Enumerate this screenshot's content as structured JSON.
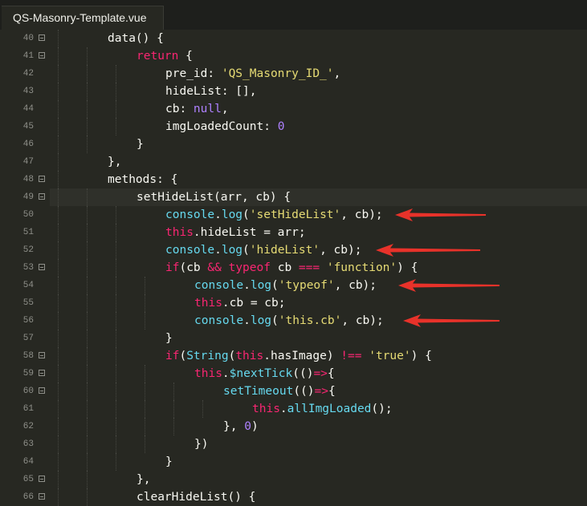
{
  "tab": {
    "filename": "QS-Masonry-Template.vue"
  },
  "current_line": 49,
  "lines": [
    {
      "num": "40",
      "fold": true,
      "indent": 2,
      "tokens": [
        [
          "p",
          "data() {"
        ]
      ]
    },
    {
      "num": "41",
      "fold": true,
      "indent": 3,
      "tokens": [
        [
          "k",
          "return"
        ],
        [
          "p",
          " {"
        ]
      ]
    },
    {
      "num": "42",
      "fold": false,
      "indent": 4,
      "tokens": [
        [
          "p",
          "pre_id: "
        ],
        [
          "s",
          "'QS_Masonry_ID_'"
        ],
        [
          "p",
          ","
        ]
      ]
    },
    {
      "num": "43",
      "fold": false,
      "indent": 4,
      "tokens": [
        [
          "p",
          "hideList: [],"
        ]
      ]
    },
    {
      "num": "44",
      "fold": false,
      "indent": 4,
      "tokens": [
        [
          "p",
          "cb: "
        ],
        [
          "n",
          "null"
        ],
        [
          "p",
          ","
        ]
      ]
    },
    {
      "num": "45",
      "fold": false,
      "indent": 4,
      "tokens": [
        [
          "p",
          "imgLoadedCount: "
        ],
        [
          "n",
          "0"
        ]
      ]
    },
    {
      "num": "46",
      "fold": false,
      "indent": 3,
      "tokens": [
        [
          "p",
          "}"
        ]
      ]
    },
    {
      "num": "47",
      "fold": false,
      "indent": 2,
      "tokens": [
        [
          "p",
          "},"
        ]
      ]
    },
    {
      "num": "48",
      "fold": true,
      "indent": 2,
      "tokens": [
        [
          "p",
          "methods: {"
        ]
      ]
    },
    {
      "num": "49",
      "fold": true,
      "indent": 3,
      "tokens": [
        [
          "p",
          "setHideList(arr, cb) {"
        ]
      ]
    },
    {
      "num": "50",
      "fold": false,
      "indent": 4,
      "tokens": [
        [
          "f",
          "console"
        ],
        [
          "p",
          "."
        ],
        [
          "f",
          "log"
        ],
        [
          "p",
          "("
        ],
        [
          "s",
          "'setHideList'"
        ],
        [
          "p",
          ", cb);"
        ]
      ]
    },
    {
      "num": "51",
      "fold": false,
      "indent": 4,
      "tokens": [
        [
          "k",
          "this"
        ],
        [
          "p",
          ".hideList = arr;"
        ]
      ]
    },
    {
      "num": "52",
      "fold": false,
      "indent": 4,
      "tokens": [
        [
          "f",
          "console"
        ],
        [
          "p",
          "."
        ],
        [
          "f",
          "log"
        ],
        [
          "p",
          "("
        ],
        [
          "s",
          "'hideList'"
        ],
        [
          "p",
          ", cb);"
        ]
      ]
    },
    {
      "num": "53",
      "fold": true,
      "indent": 4,
      "tokens": [
        [
          "k",
          "if"
        ],
        [
          "p",
          "(cb "
        ],
        [
          "k",
          "&&"
        ],
        [
          "p",
          " "
        ],
        [
          "k",
          "typeof"
        ],
        [
          "p",
          " cb "
        ],
        [
          "k",
          "==="
        ],
        [
          "p",
          " "
        ],
        [
          "s",
          "'function'"
        ],
        [
          "p",
          ") {"
        ]
      ]
    },
    {
      "num": "54",
      "fold": false,
      "indent": 5,
      "tokens": [
        [
          "f",
          "console"
        ],
        [
          "p",
          "."
        ],
        [
          "f",
          "log"
        ],
        [
          "p",
          "("
        ],
        [
          "s",
          "'typeof'"
        ],
        [
          "p",
          ", cb);"
        ]
      ]
    },
    {
      "num": "55",
      "fold": false,
      "indent": 5,
      "tokens": [
        [
          "k",
          "this"
        ],
        [
          "p",
          ".cb = cb;"
        ]
      ]
    },
    {
      "num": "56",
      "fold": false,
      "indent": 5,
      "tokens": [
        [
          "f",
          "console"
        ],
        [
          "p",
          "."
        ],
        [
          "f",
          "log"
        ],
        [
          "p",
          "("
        ],
        [
          "s",
          "'this.cb'"
        ],
        [
          "p",
          ", cb);"
        ]
      ]
    },
    {
      "num": "57",
      "fold": false,
      "indent": 4,
      "tokens": [
        [
          "p",
          "}"
        ]
      ]
    },
    {
      "num": "58",
      "fold": true,
      "indent": 4,
      "tokens": [
        [
          "k",
          "if"
        ],
        [
          "p",
          "("
        ],
        [
          "f",
          "String"
        ],
        [
          "p",
          "("
        ],
        [
          "k",
          "this"
        ],
        [
          "p",
          ".hasImage) "
        ],
        [
          "k",
          "!=="
        ],
        [
          "p",
          " "
        ],
        [
          "s",
          "'true'"
        ],
        [
          "p",
          ") {"
        ]
      ]
    },
    {
      "num": "59",
      "fold": true,
      "indent": 5,
      "tokens": [
        [
          "k",
          "this"
        ],
        [
          "p",
          "."
        ],
        [
          "f",
          "$nextTick"
        ],
        [
          "p",
          "(()"
        ],
        [
          "k",
          "=>"
        ],
        [
          "p",
          "{"
        ]
      ]
    },
    {
      "num": "60",
      "fold": true,
      "indent": 6,
      "tokens": [
        [
          "f",
          "setTimeout"
        ],
        [
          "p",
          "(()"
        ],
        [
          "k",
          "=>"
        ],
        [
          "p",
          "{"
        ]
      ]
    },
    {
      "num": "61",
      "fold": false,
      "indent": 7,
      "tokens": [
        [
          "k",
          "this"
        ],
        [
          "p",
          "."
        ],
        [
          "f",
          "allImgLoaded"
        ],
        [
          "p",
          "();"
        ]
      ]
    },
    {
      "num": "62",
      "fold": false,
      "indent": 6,
      "tokens": [
        [
          "p",
          "}, "
        ],
        [
          "n",
          "0"
        ],
        [
          "p",
          ")"
        ]
      ]
    },
    {
      "num": "63",
      "fold": false,
      "indent": 5,
      "tokens": [
        [
          "p",
          "})"
        ]
      ]
    },
    {
      "num": "64",
      "fold": false,
      "indent": 4,
      "tokens": [
        [
          "p",
          "}"
        ]
      ]
    },
    {
      "num": "65",
      "fold": true,
      "indent": 3,
      "tokens": [
        [
          "p",
          "},"
        ]
      ]
    },
    {
      "num": "66",
      "fold": true,
      "indent": 3,
      "tokens": [
        [
          "p",
          "clearHideList() {"
        ]
      ]
    }
  ],
  "annotations": [
    {
      "line": "50",
      "label": "red-arrow"
    },
    {
      "line": "52",
      "label": "red-arrow"
    },
    {
      "line": "54",
      "label": "red-arrow"
    },
    {
      "line": "56",
      "label": "red-arrow"
    }
  ],
  "colors": {
    "background": "#272822",
    "keyword": "#f92672",
    "string": "#e6db74",
    "number": "#ae81ff",
    "function": "#66d9ef",
    "arrow": "#e8322a"
  }
}
